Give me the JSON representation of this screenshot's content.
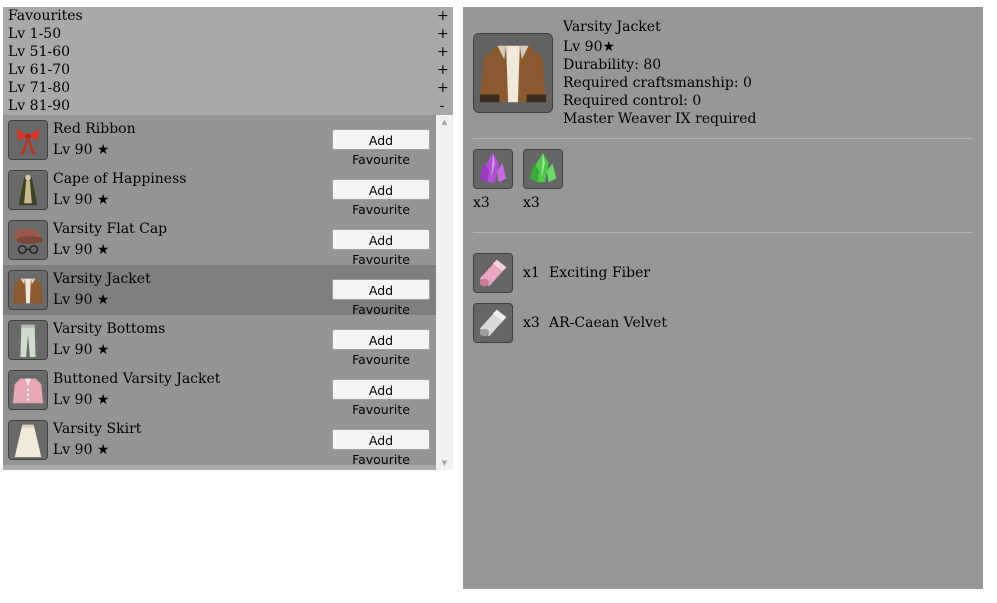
{
  "categories": [
    {
      "label": "Favourites",
      "toggle": "+"
    },
    {
      "label": "Lv 1-50",
      "toggle": "+"
    },
    {
      "label": "Lv 51-60",
      "toggle": "+"
    },
    {
      "label": "Lv 61-70",
      "toggle": "+"
    },
    {
      "label": "Lv 71-80",
      "toggle": "+"
    },
    {
      "label": "Lv 81-90",
      "toggle": "-"
    }
  ],
  "items": [
    {
      "name": "Red Ribbon",
      "level": "Lv 90 ★",
      "button": "Add Favourite",
      "icon": "red-ribbon-icon",
      "selected": false
    },
    {
      "name": "Cape of Happiness",
      "level": "Lv 90 ★",
      "button": "Add Favourite",
      "icon": "cape-icon",
      "selected": false
    },
    {
      "name": "Varsity Flat Cap",
      "level": "Lv 90 ★",
      "button": "Add Favourite",
      "icon": "flat-cap-icon",
      "selected": false
    },
    {
      "name": "Varsity Jacket",
      "level": "Lv 90 ★",
      "button": "Add Favourite",
      "icon": "jacket-icon",
      "selected": true
    },
    {
      "name": "Varsity Bottoms",
      "level": "Lv 90 ★",
      "button": "Add Favourite",
      "icon": "bottoms-icon",
      "selected": false
    },
    {
      "name": "Buttoned Varsity Jacket",
      "level": "Lv 90 ★",
      "button": "Add Favourite",
      "icon": "pink-jacket-icon",
      "selected": false
    },
    {
      "name": "Varsity Skirt",
      "level": "Lv 90 ★",
      "button": "Add Favourite",
      "icon": "skirt-icon",
      "selected": false
    }
  ],
  "scrollbar": {
    "up": "▲",
    "down": "▼"
  },
  "detail": {
    "name": "Varsity Jacket",
    "level": "Lv 90★",
    "durability": "Durability: 80",
    "craftsmanship": "Required craftsmanship: 0",
    "control": "Required control: 0",
    "requirement": "Master Weaver IX required",
    "icon": "jacket-icon",
    "crystals": [
      {
        "qty": "x3",
        "icon": "purple-crystal-icon",
        "color": "#b24fd6"
      },
      {
        "qty": "x3",
        "icon": "green-crystal-icon",
        "color": "#4fc94a"
      }
    ],
    "materials": [
      {
        "qty": "x1",
        "name": "Exciting Fiber",
        "icon": "pink-cloth-icon",
        "color": "#e7a6c4"
      },
      {
        "qty": "x3",
        "name": "AR-Caean Velvet",
        "icon": "silver-cloth-icon",
        "color": "#d9d9d9"
      }
    ]
  },
  "colors": {
    "list_bg": "#a9a9a9",
    "row_bg": "#959595",
    "row_selected": "#7f7f7f",
    "detail_bg": "#979797"
  }
}
